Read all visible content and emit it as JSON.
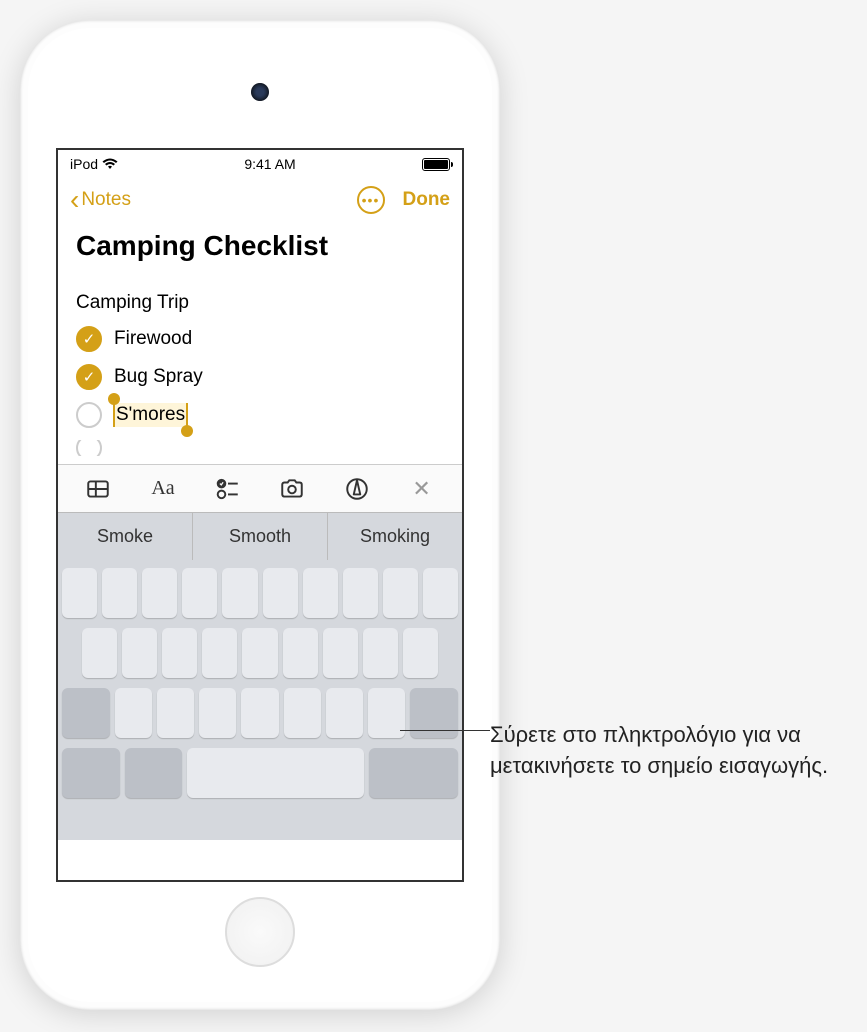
{
  "status": {
    "carrier": "iPod",
    "time": "9:41 AM"
  },
  "nav": {
    "back_label": "Notes",
    "done_label": "Done"
  },
  "note": {
    "title": "Camping Checklist",
    "list_header": "Camping Trip",
    "items": [
      {
        "label": "Firewood",
        "checked": true
      },
      {
        "label": "Bug Spray",
        "checked": true
      },
      {
        "label": "S'mores",
        "checked": false,
        "selected": true
      }
    ]
  },
  "suggestions": [
    "Smoke",
    "Smooth",
    "Smoking"
  ],
  "callout": {
    "text": "Σύρετε στο πληκτρολόγιο για να μετακινήσετε το σημείο εισαγωγής."
  },
  "icons": {
    "table": "table-icon",
    "format": "Aa",
    "checklist": "checklist-icon",
    "camera": "camera-icon",
    "markup": "markup-icon",
    "close": "✕"
  }
}
